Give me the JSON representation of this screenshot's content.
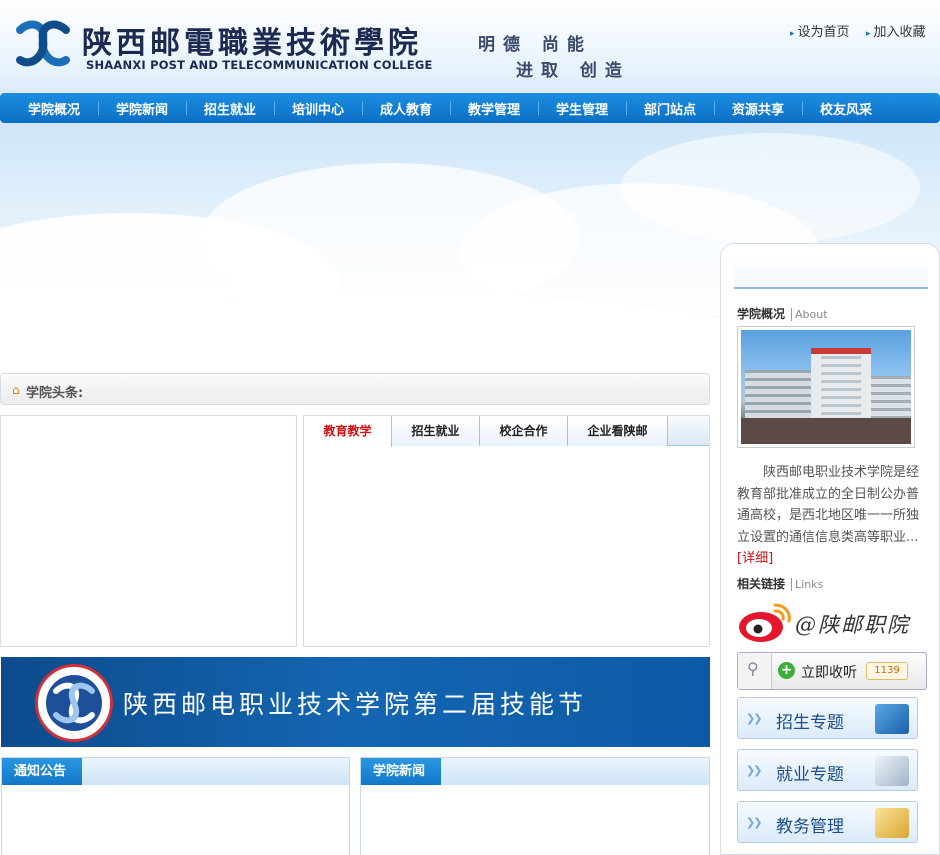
{
  "header": {
    "logo_cn": "陕西邮電職業技術學院",
    "logo_en": "SHAANXI POST AND TELECOMMUNICATION COLLEGE",
    "motto_line1": "明德 尚能",
    "motto_line2": "进取 创造",
    "links": [
      {
        "label": "设为首页"
      },
      {
        "label": "加入收藏"
      }
    ]
  },
  "nav": {
    "items": [
      "学院概况",
      "学院新闻",
      "招生就业",
      "培训中心",
      "成人教育",
      "教学管理",
      "学生管理",
      "部门站点",
      "资源共享",
      "校友风采"
    ]
  },
  "headline": {
    "label": "学院头条:"
  },
  "tabs": {
    "items": [
      {
        "label": "教育教学",
        "active": true
      },
      {
        "label": "招生就业",
        "active": false
      },
      {
        "label": "校企合作",
        "active": false
      },
      {
        "label": "企业看陕邮",
        "active": false
      }
    ]
  },
  "skill_banner": {
    "text": "陕西邮电职业技术学院第二届技能节"
  },
  "panels": {
    "notices": {
      "title": "通知公告"
    },
    "news": {
      "title": "学院新闻"
    }
  },
  "sidebar": {
    "about": {
      "title": "学院概况",
      "subtitle": "About",
      "text": "陕西邮电职业技术学院是经教育部批准成立的全日制公办普通高校，是西北地区唯一一所独立设置的通信信息类高等职业...",
      "more": "[详细]"
    },
    "links": {
      "title": "相关链接",
      "subtitle": "Links"
    },
    "weibo": {
      "handle": "@陕邮职院"
    },
    "follow": {
      "label": "立即收听",
      "count": "1139"
    },
    "buttons": [
      {
        "label": "招生专题",
        "icon": "computer-icon"
      },
      {
        "label": "就业专题",
        "icon": "handshake-icon"
      },
      {
        "label": "教务管理",
        "icon": "folder-icon"
      }
    ]
  },
  "colors": {
    "nav": "#1282d4",
    "accent_red": "#d01010",
    "panel_tab": "#1a85d6"
  }
}
